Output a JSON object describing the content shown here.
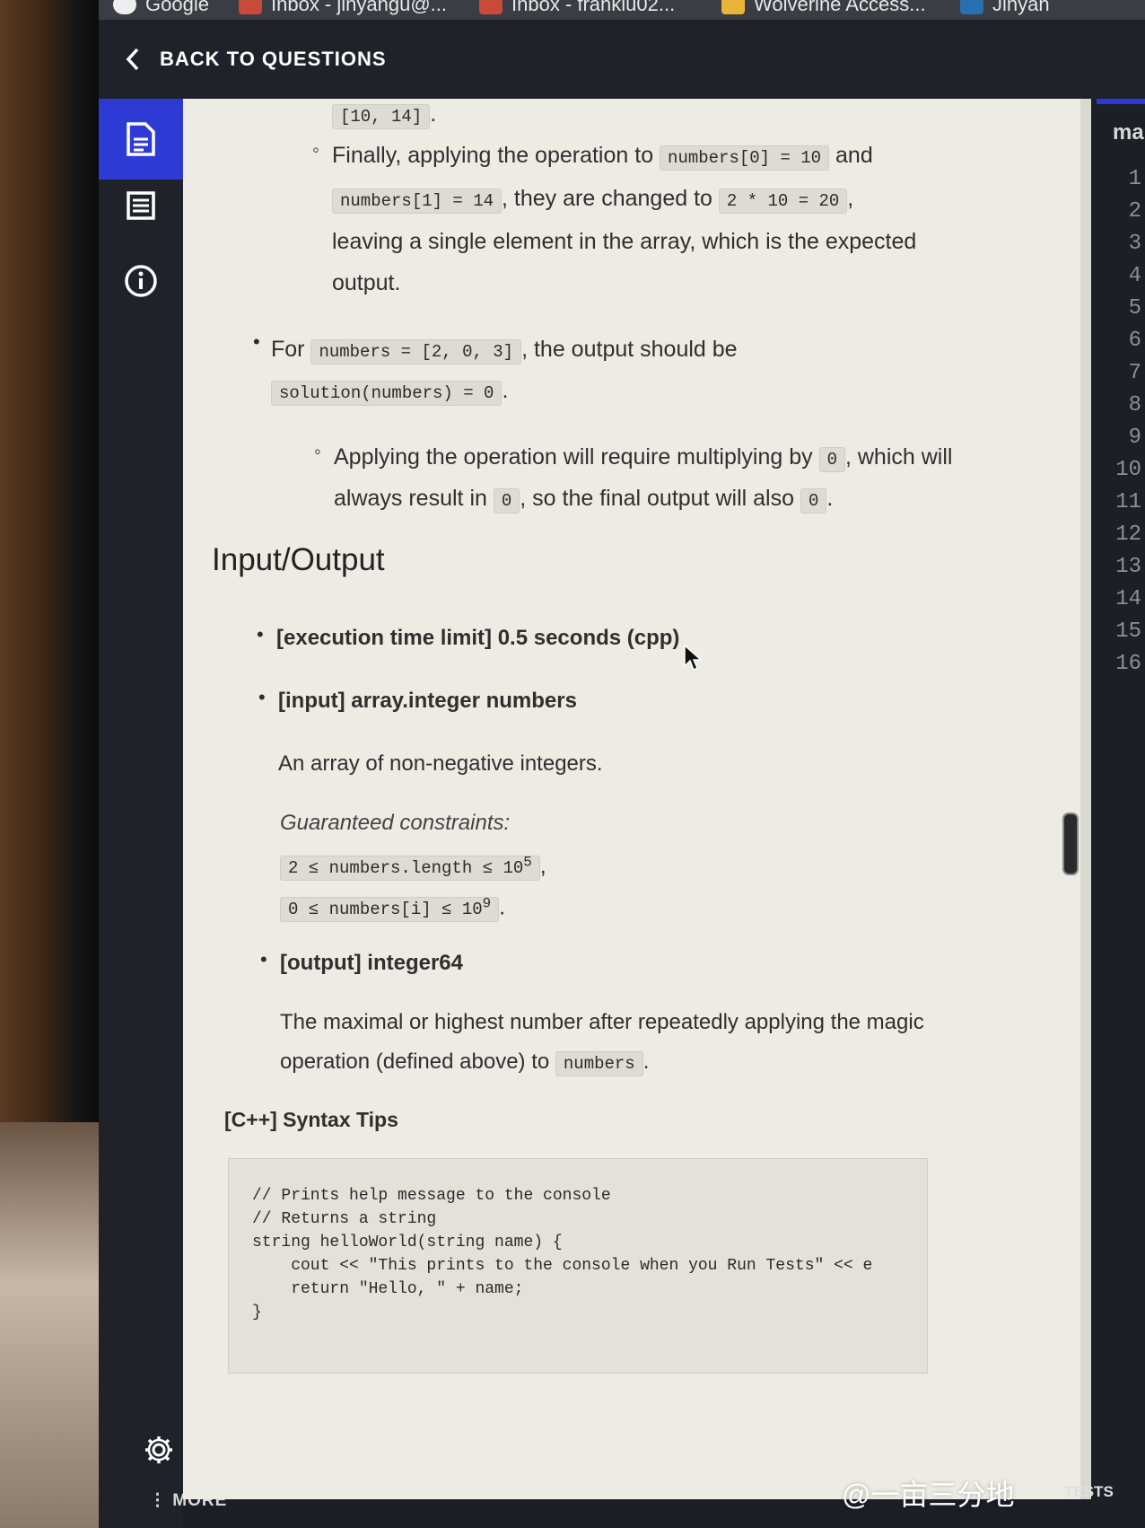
{
  "bookmarks": [
    "Google",
    "Inbox - jinyangu@...",
    "Inbox - franklu02...",
    "Wolverine Access...",
    "Jinyan"
  ],
  "header": {
    "back_label": "BACK TO QUESTIONS"
  },
  "rail": {
    "items": [
      "description-icon",
      "table-icon",
      "info-icon"
    ],
    "more_label": "MORE"
  },
  "description": {
    "prev_code": "[10, 14]",
    "prev_after": ".",
    "finally_text": "Finally, applying the operation to",
    "code_n0": "numbers[0] = 10",
    "and_text": "and",
    "code_n1": "numbers[1] = 14",
    "changed_text": ", they are changed to",
    "code_2x10": "2 * 10 = 20",
    "comma": ",",
    "leaving_text": "leaving a single element in the array, which is the expected",
    "output_text": "output.",
    "for_text": "For",
    "code_numbers": "numbers = [2, 0, 3]",
    "output_should": ", the output should be",
    "code_solution": "solution(numbers) = 0",
    "period": ".",
    "applying_text": "Applying the operation will require multiplying by",
    "code_zero": "0",
    "which_will": ", which will",
    "always_text": "always result in",
    "so_final": ", so the final output will also"
  },
  "io": {
    "heading": "Input/Output",
    "time_limit": "[execution time limit] 0.5 seconds (cpp)",
    "input_label": "[input] array.integer numbers",
    "input_desc": "An array of non-negative integers.",
    "constraints_label": "Guaranteed constraints:",
    "constraint1": "2 ≤ numbers.length ≤ 10",
    "constraint1_exp": "5",
    "constraint2": "0 ≤ numbers[i] ≤ 10",
    "constraint2_exp": "9",
    "output_label": "[output] integer64",
    "output_desc_1": "The maximal or highest number after repeatedly applying the magic",
    "output_desc_2": "operation (defined above) to",
    "output_code": "numbers"
  },
  "syntax": {
    "heading": "[C++] Syntax Tips",
    "lines": [
      "// Prints help message to the console",
      "// Returns a string",
      "string helloWorld(string name) {",
      "    cout << \"This prints to the console when you Run Tests\" << e",
      "    return \"Hello, \" + name;",
      "}"
    ]
  },
  "editor": {
    "title": "ma",
    "line_numbers": [
      "1",
      "2",
      "3",
      "4",
      "5",
      "6",
      "7",
      "8",
      "9",
      "10",
      "11",
      "12",
      "13",
      "14",
      "15",
      "16"
    ],
    "tests_label": "TESTS"
  },
  "watermark": "@一亩三分地",
  "colors": {
    "accent": "#2d3bd4",
    "panel_bg": "#ecebe4",
    "dark_bg": "#1f2229"
  }
}
